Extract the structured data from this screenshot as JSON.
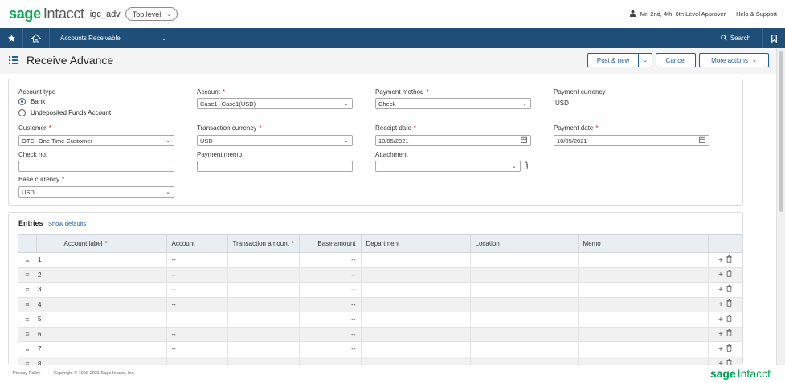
{
  "brand": {
    "sage": "sage",
    "intacct": "Intacct",
    "color": "#00a651"
  },
  "company": "igc_adv",
  "level": "Top level",
  "user": "Mr. 2nd, 4th, 6th Level Approver",
  "help": "Help & Support",
  "nav": {
    "module": "Accounts Receivable",
    "search": "Search",
    "bar_color": "#1f4e79"
  },
  "page": {
    "title": "Receive Advance"
  },
  "actions": {
    "post_new": "Post & new",
    "cancel": "Cancel",
    "more_actions": "More actions"
  },
  "form": {
    "account_type": {
      "label": "Account type",
      "options": [
        {
          "label": "Bank",
          "selected": true
        },
        {
          "label": "Undeposited Funds Account",
          "selected": false
        }
      ]
    },
    "account": {
      "label": "Account",
      "value": "Case1--Case1(USD)"
    },
    "payment_method": {
      "label": "Payment method",
      "value": "Check"
    },
    "payment_currency": {
      "label": "Payment currency",
      "value": "USD"
    },
    "customer": {
      "label": "Customer",
      "value": "OTC--One Time Customer"
    },
    "transaction_currency": {
      "label": "Transaction currency",
      "value": "USD"
    },
    "receipt_date": {
      "label": "Receipt date",
      "value": "10/05/2021"
    },
    "payment_date": {
      "label": "Payment date",
      "value": "10/05/2021"
    },
    "check_no": {
      "label": "Check no.",
      "value": ""
    },
    "payment_memo": {
      "label": "Payment memo",
      "value": ""
    },
    "attachment": {
      "label": "Attachment",
      "value": ""
    },
    "base_currency": {
      "label": "Base currency",
      "value": "USD"
    }
  },
  "entries": {
    "title": "Entries",
    "show_defaults": "Show defaults",
    "columns": [
      "Account label",
      "Account",
      "Transaction amount",
      "Base amount",
      "Department",
      "Location",
      "Memo"
    ],
    "rows": [
      {
        "n": "1",
        "account": "--",
        "base": "--"
      },
      {
        "n": "2",
        "account": "--",
        "base": "--"
      },
      {
        "n": "3",
        "account": "--",
        "base": "--"
      },
      {
        "n": "4",
        "account": "--",
        "base": "--"
      },
      {
        "n": "5",
        "account": "",
        "base": "--"
      },
      {
        "n": "6",
        "account": "--",
        "base": "--"
      },
      {
        "n": "7",
        "account": "--",
        "base": "--"
      },
      {
        "n": "8",
        "account": "",
        "base": ""
      }
    ]
  },
  "footer": {
    "privacy": "Privacy Policy",
    "copyright": "Copyright © 1999-2021 Sage Intacct, Inc."
  }
}
